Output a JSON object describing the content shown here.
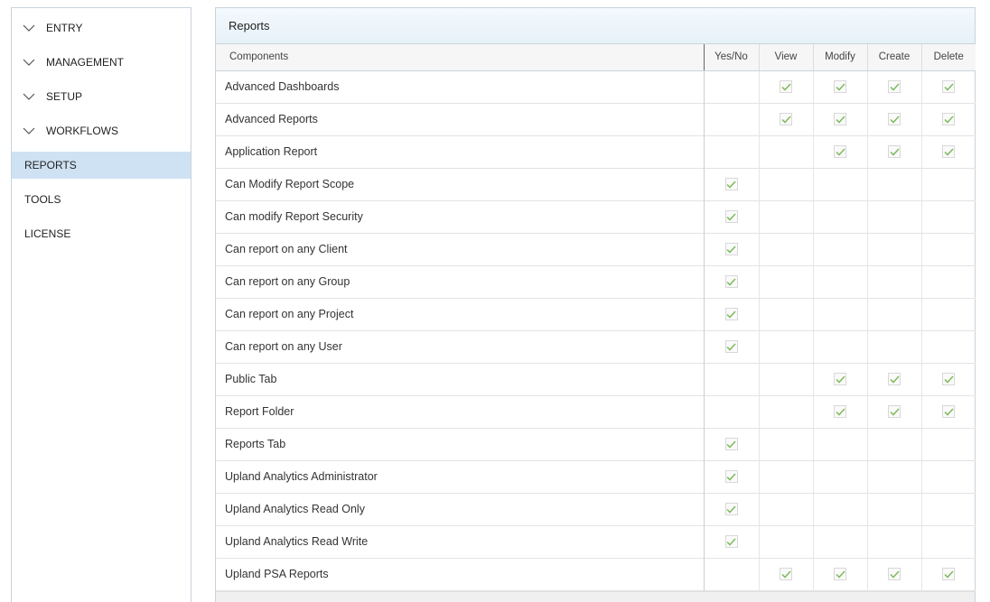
{
  "sidebar": {
    "items": [
      {
        "label": "ENTRY",
        "expandable": true,
        "icon": "chevron-down-icon"
      },
      {
        "label": "MANAGEMENT",
        "expandable": true,
        "icon": "chevron-down-icon"
      },
      {
        "label": "SETUP",
        "expandable": true,
        "icon": "chevron-down-icon"
      },
      {
        "label": "WORKFLOWS",
        "expandable": true,
        "icon": "chevron-down-icon"
      },
      {
        "label": "REPORTS",
        "expandable": false,
        "active": true
      },
      {
        "label": "TOOLS",
        "expandable": false
      },
      {
        "label": "LICENSE",
        "expandable": false
      }
    ]
  },
  "panel": {
    "title": "Reports",
    "columns": [
      "Components",
      "Yes/No",
      "View",
      "Modify",
      "Create",
      "Delete"
    ],
    "rows": [
      {
        "name": "Advanced Dashboards",
        "checks": [
          false,
          true,
          true,
          true,
          true
        ]
      },
      {
        "name": "Advanced Reports",
        "checks": [
          false,
          true,
          true,
          true,
          true
        ]
      },
      {
        "name": "Application Report",
        "checks": [
          false,
          false,
          true,
          true,
          true
        ]
      },
      {
        "name": "Can Modify Report Scope",
        "checks": [
          true,
          false,
          false,
          false,
          false
        ]
      },
      {
        "name": "Can modify Report Security",
        "checks": [
          true,
          false,
          false,
          false,
          false
        ]
      },
      {
        "name": "Can report on any Client",
        "checks": [
          true,
          false,
          false,
          false,
          false
        ]
      },
      {
        "name": "Can report on any Group",
        "checks": [
          true,
          false,
          false,
          false,
          false
        ]
      },
      {
        "name": "Can report on any Project",
        "checks": [
          true,
          false,
          false,
          false,
          false
        ]
      },
      {
        "name": "Can report on any User",
        "checks": [
          true,
          false,
          false,
          false,
          false
        ]
      },
      {
        "name": "Public Tab",
        "checks": [
          false,
          false,
          true,
          true,
          true
        ]
      },
      {
        "name": "Report Folder",
        "checks": [
          false,
          false,
          true,
          true,
          true
        ]
      },
      {
        "name": "Reports Tab",
        "checks": [
          true,
          false,
          false,
          false,
          false
        ]
      },
      {
        "name": "Upland Analytics Administrator",
        "checks": [
          true,
          false,
          false,
          false,
          false
        ]
      },
      {
        "name": "Upland Analytics Read Only",
        "checks": [
          true,
          false,
          false,
          false,
          false
        ]
      },
      {
        "name": "Upland Analytics Read Write",
        "checks": [
          true,
          false,
          false,
          false,
          false
        ]
      },
      {
        "name": "Upland PSA Reports",
        "checks": [
          false,
          true,
          true,
          true,
          true
        ]
      }
    ]
  },
  "colors": {
    "accent_active": "#cfe2f3",
    "check_green": "#7dbb5a",
    "border": "#c9d3dc"
  }
}
